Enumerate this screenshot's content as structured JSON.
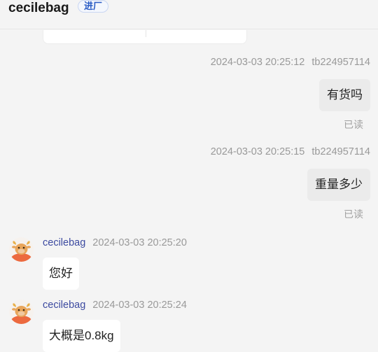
{
  "header": {
    "shop_name": "cecilebag",
    "badge": "进厂"
  },
  "messages": [
    {
      "direction": "outgoing",
      "time": "2024-03-03 20:25:12",
      "sender": "tb224957114",
      "text": "有货吗",
      "status": "已读"
    },
    {
      "direction": "outgoing",
      "time": "2024-03-03 20:25:15",
      "sender": "tb224957114",
      "text": "重量多少",
      "status": "已读"
    },
    {
      "direction": "incoming",
      "sender": "cecilebag",
      "time": "2024-03-03 20:25:20",
      "text": "您好",
      "avatar": "cartoon-cow-icon"
    },
    {
      "direction": "incoming",
      "sender": "cecilebag",
      "time": "2024-03-03 20:25:24",
      "text": "大概是0.8kg",
      "avatar": "cartoon-cow-icon"
    }
  ],
  "colors": {
    "background": "#f4f4f4",
    "outgoing_bubble": "#ebebeb",
    "incoming_bubble": "#ffffff",
    "sender_name": "#3c4aa0",
    "badge_text": "#2a5cc5",
    "meta_text": "#999999"
  }
}
